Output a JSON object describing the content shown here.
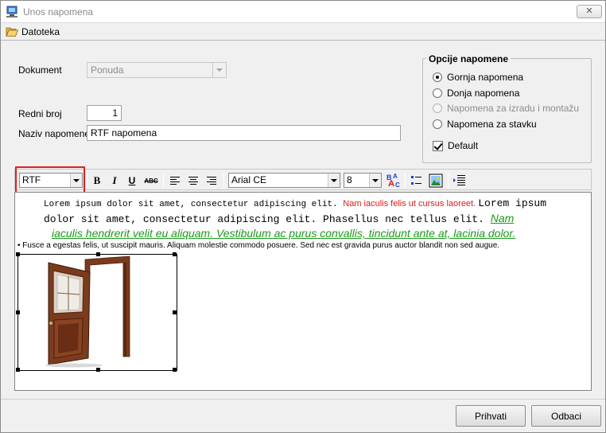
{
  "window": {
    "title": "Unos napomena",
    "close_glyph": "✕",
    "app_icon": "monitor-icon"
  },
  "menu": {
    "file_label": "Datoteka",
    "file_icon": "folder-open-icon"
  },
  "form": {
    "dokument_label": "Dokument",
    "dokument_value": "Ponuda",
    "redni_broj_label": "Redni broj",
    "redni_broj_value": "1",
    "naziv_label": "Naziv napomene",
    "naziv_value": "RTF napomena"
  },
  "options": {
    "title": "Opcije napomene",
    "radios": [
      {
        "label": "Gornja napomena",
        "checked": true,
        "enabled": true
      },
      {
        "label": "Donja napomena",
        "checked": false,
        "enabled": true
      },
      {
        "label": "Napomena za izradu i montažu",
        "checked": false,
        "enabled": false
      },
      {
        "label": "Napomena za stavku",
        "checked": false,
        "enabled": true
      }
    ],
    "default_label": "Default",
    "default_checked": true
  },
  "toolbar": {
    "format_value": "RTF",
    "bold": "B",
    "italic": "I",
    "underline": "U",
    "strike": "ABC",
    "font_value": "Arial CE",
    "size_value": "8"
  },
  "editor": {
    "p1_mono": "Lorem ipsum dolor sit amet, consectetur adipiscing elit. ",
    "p1_red": "Nam iaculis felis ut cursus laoreet. ",
    "p1_big": "Lorem ipsum",
    "line2": "dolor sit amet, consectetur adipiscing elit. Phasellus nec tellus elit. ",
    "line2_green": "Nam",
    "line3_green": "iaculis hendrerit velit eu aliquam. Vestibulum ac purus convallis, tincidunt ante at, lacinia dolor.",
    "bullet_text": "• Fusce a egestas felis, ut suscipit mauris. Aliquam molestie commodo posuere. Sed nec est gravida purus auctor blandit non sed augue.",
    "image": "door-image"
  },
  "buttons": {
    "accept": "Prihvati",
    "cancel": "Odbaci"
  },
  "colors": {
    "highlight_frame": "#e02020",
    "red_text": "#e01818",
    "green_text": "#1a9a1a"
  }
}
